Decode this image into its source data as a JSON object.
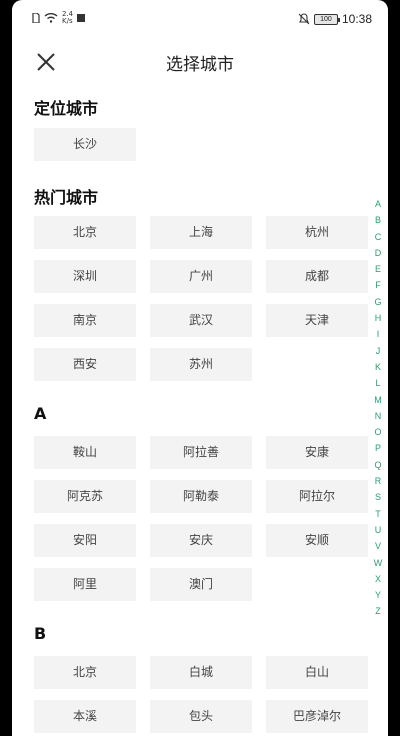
{
  "status": {
    "network": "2.4\nK/s",
    "battery": "100",
    "time": "10:38"
  },
  "header": {
    "title": "选择城市",
    "close_icon": "close-icon"
  },
  "sections": {
    "location": {
      "title": "定位城市",
      "cities": [
        "长沙"
      ]
    },
    "hot": {
      "title": "热门城市",
      "cities": [
        "北京",
        "上海",
        "杭州",
        "深圳",
        "广州",
        "成都",
        "南京",
        "武汉",
        "天津",
        "西安",
        "苏州"
      ]
    },
    "a": {
      "title": "A",
      "cities": [
        "鞍山",
        "阿拉善",
        "安康",
        "阿克苏",
        "阿勒泰",
        "阿拉尔",
        "安阳",
        "安庆",
        "安顺",
        "阿里",
        "澳门"
      ]
    },
    "b": {
      "title": "B",
      "cities": [
        "北京",
        "白城",
        "白山",
        "本溪",
        "包头",
        "巴彦淖尔"
      ]
    }
  },
  "alphabet": [
    "A",
    "B",
    "C",
    "D",
    "E",
    "F",
    "G",
    "H",
    "I",
    "J",
    "K",
    "L",
    "M",
    "N",
    "O",
    "P",
    "Q",
    "R",
    "S",
    "T",
    "U",
    "V",
    "W",
    "X",
    "Y",
    "Z"
  ],
  "colors": {
    "accent": "#2a9d6e",
    "tag_bg": "#f3f3f3"
  }
}
